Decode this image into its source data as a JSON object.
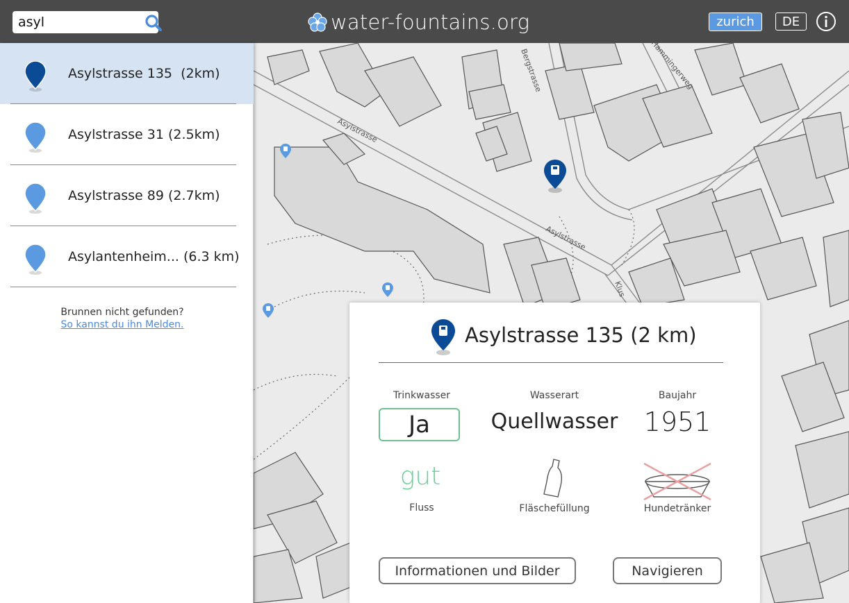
{
  "header": {
    "search": {
      "value": "asyl",
      "icon": "search-icon"
    },
    "brand": {
      "title": "water-fountains.org",
      "logo": "water-drops-logo-icon"
    },
    "city_button": "zurich",
    "language_button": "DE",
    "info_icon": "info-icon",
    "colors": {
      "bar": "#4a4a4a",
      "accent": "#5b9ae0"
    }
  },
  "sidebar": {
    "results": [
      {
        "label": "Asylstrasse 135  (2km)",
        "active": true,
        "pin_color": "#0b4a94"
      },
      {
        "label": "Asylstrasse 31 (2.5km)",
        "active": false,
        "pin_color": "#5b9ae0"
      },
      {
        "label": "Asylstrasse 89 (2.7km)",
        "active": false,
        "pin_color": "#5b9ae0"
      },
      {
        "label": "Asylantenheim... (6.3 km)",
        "active": false,
        "pin_color": "#5b9ae0"
      }
    ],
    "not_found_text": "Brunnen nicht gefunden?",
    "not_found_link": "So kannst du ihn Melden."
  },
  "map": {
    "street_labels": [
      "Asylstrasse",
      "Asylstrasse",
      "Bergstrasse",
      "Hammingerweg",
      "Klus"
    ]
  },
  "card": {
    "title": "Asylstrasse 135 (2 km)",
    "trinkwasser_label": "Trinkwasser",
    "trinkwasser_value": "Ja",
    "wasserart_label": "Wasserart",
    "wasserart_value": "Quellwasser",
    "baujahr_label": "Baujahr",
    "baujahr_value": "1951",
    "fluss_value": "gut",
    "fluss_label": "Fluss",
    "flasche_label": "Fläschefüllung",
    "hund_label": "Hundetränker",
    "hund_available": false,
    "info_button": "Informationen und Bilder",
    "nav_button": "Navigieren"
  }
}
